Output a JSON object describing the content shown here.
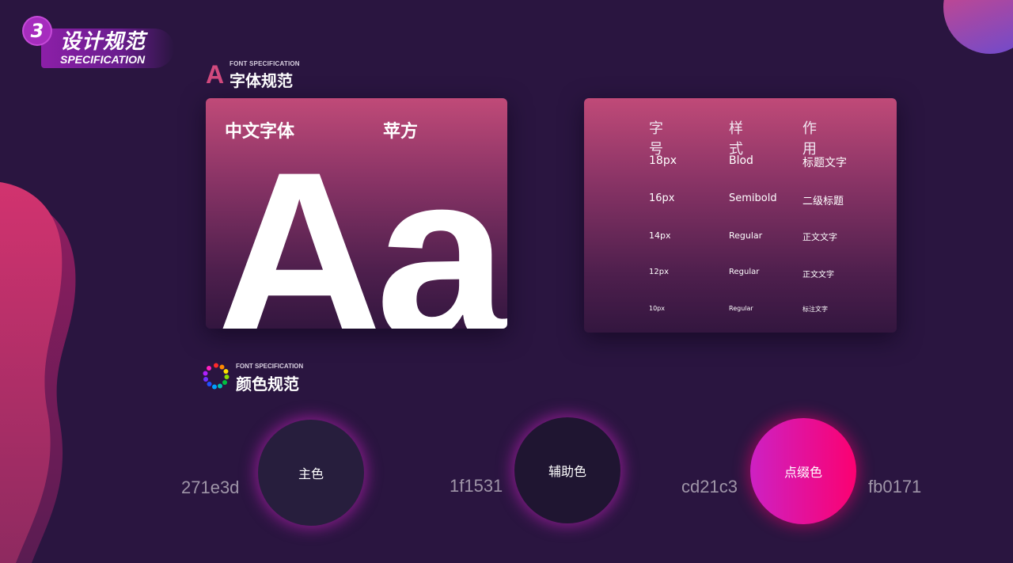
{
  "section": {
    "number": "3",
    "title": "设计规范",
    "subtitle": "SPECIFICATION"
  },
  "font_section": {
    "icon": "A",
    "eng": "FONT SPECIFICATION",
    "title": "字体规范"
  },
  "font_card": {
    "label_cn": "中文字体",
    "font_name": "苹方",
    "sample": "Aa"
  },
  "font_table": {
    "headers": [
      "字号",
      "样式",
      "作用"
    ],
    "rows": [
      {
        "size": "18px",
        "style": "Blod",
        "usage": "标题文字"
      },
      {
        "size": "16px",
        "style": "Semibold",
        "usage": "二级标题"
      },
      {
        "size": "14px",
        "style": "Regular",
        "usage": "正文文字"
      },
      {
        "size": "12px",
        "style": "Regular",
        "usage": "正文文字"
      },
      {
        "size": "10px",
        "style": "Regular",
        "usage": "标注文字"
      }
    ]
  },
  "color_section": {
    "eng": "FONT SPECIFICATION",
    "title": "颜色规范"
  },
  "colors": {
    "primary": {
      "label": "主色",
      "hex": "271e3d"
    },
    "secondary": {
      "label": "辅助色",
      "hex": "1f1531"
    },
    "accent": {
      "label": "点缀色",
      "hex_start": "cd21c3",
      "hex_end": "fb0171"
    }
  }
}
